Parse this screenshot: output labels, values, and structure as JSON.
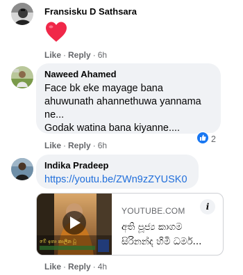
{
  "comments": [
    {
      "author": "Fransisku D Sathsara",
      "content_emoji": "heart",
      "actions": {
        "like": "Like",
        "reply": "Reply",
        "time": "6h"
      }
    },
    {
      "author": "Naweed Ahamed",
      "lines": [
        "Face bk eke mayage bana",
        "ahuwunath ahannethuwa yannama",
        "ne...",
        "Godak watina bana kiyanne...."
      ],
      "reactions": {
        "icon": "like-reaction-icon",
        "count": "2"
      },
      "actions": {
        "like": "Like",
        "reply": "Reply",
        "time": "6h"
      }
    },
    {
      "author": "Indika Pradeep",
      "link_text": "https://youtu.be/ZWn9zZYUSK0",
      "link_preview": {
        "source": "YOUTUBE.COM",
        "title": "අති පූජ්‍ය කාගම සිරිනන්ද හිමි ධර්ම...",
        "info_icon": "i",
        "thumbnail_caption": "මේ ඉතා කාලීන වූ"
      },
      "actions": {
        "like": "Like",
        "reply": "Reply",
        "time": "4h"
      }
    }
  ],
  "colors": {
    "bubble": "#f0f2f5",
    "link": "#216fdb",
    "meta": "#65676b",
    "heart": "#f02849",
    "like_blue": "#1877f2"
  }
}
